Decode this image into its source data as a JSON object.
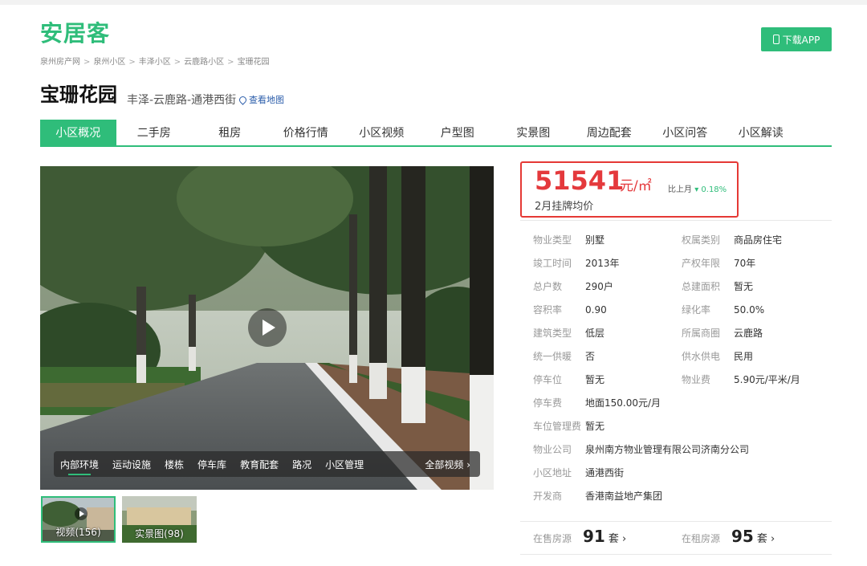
{
  "header": {
    "logo": "安居客",
    "breadcrumbs": [
      "泉州房产网",
      "泉州小区",
      "丰泽小区",
      "云鹿路小区",
      "宝珊花园"
    ],
    "app_button": "下载APP"
  },
  "community": {
    "name": "宝珊花园",
    "location": "丰泽-云鹿路-通港西街",
    "map_link": "查看地图"
  },
  "tabs": [
    "小区概况",
    "二手房",
    "租房",
    "价格行情",
    "小区视频",
    "户型图",
    "实景图",
    "周边配套",
    "小区问答",
    "小区解读"
  ],
  "video_bar": {
    "items": [
      "内部环境",
      "运动设施",
      "楼栋",
      "停车库",
      "教育配套",
      "路况",
      "小区管理"
    ],
    "all_label": "全部视频 ›"
  },
  "thumbs": [
    {
      "label": "视频(156)"
    },
    {
      "label": "实景图(98)"
    }
  ],
  "price": {
    "value": "51541",
    "unit": "元/㎡",
    "compare_label": "比上月",
    "compare_arrow": "▾",
    "compare_value": "0.18%",
    "label": "2月挂牌均价"
  },
  "info": {
    "col1": [
      {
        "k": "物业类型",
        "v": "别墅"
      },
      {
        "k": "竣工时间",
        "v": "2013年"
      },
      {
        "k": "总户数",
        "v": "290户"
      },
      {
        "k": "容积率",
        "v": "0.90"
      },
      {
        "k": "建筑类型",
        "v": "低层"
      },
      {
        "k": "统一供暖",
        "v": "否"
      },
      {
        "k": "停车位",
        "v": "暂无"
      },
      {
        "k": "停车费",
        "v": "地面150.00元/月"
      },
      {
        "k": "车位管理费",
        "v": "暂无"
      },
      {
        "k": "物业公司",
        "v": "泉州南方物业管理有限公司济南分公司"
      },
      {
        "k": "小区地址",
        "v": "通港西街"
      },
      {
        "k": "开发商",
        "v": "香港南益地产集团"
      }
    ],
    "col2": [
      {
        "k": "权属类别",
        "v": "商品房住宅"
      },
      {
        "k": "产权年限",
        "v": "70年"
      },
      {
        "k": "总建面积",
        "v": "暂无"
      },
      {
        "k": "绿化率",
        "v": "50.0%"
      },
      {
        "k": "所属商圈",
        "v": "云鹿路"
      },
      {
        "k": "供水供电",
        "v": "民用"
      },
      {
        "k": "物业费",
        "v": "5.90元/平米/月"
      }
    ]
  },
  "listings": {
    "sale_label": "在售房源",
    "sale_count": "91",
    "rent_label": "在租房源",
    "rent_count": "95",
    "unit": "套 ›"
  },
  "colors": {
    "brand": "#2fbd7a",
    "price_red": "#e4393c",
    "highlight_box": "#e53935"
  },
  "icons": [
    "phone-icon",
    "map-pin-icon",
    "play-icon"
  ]
}
